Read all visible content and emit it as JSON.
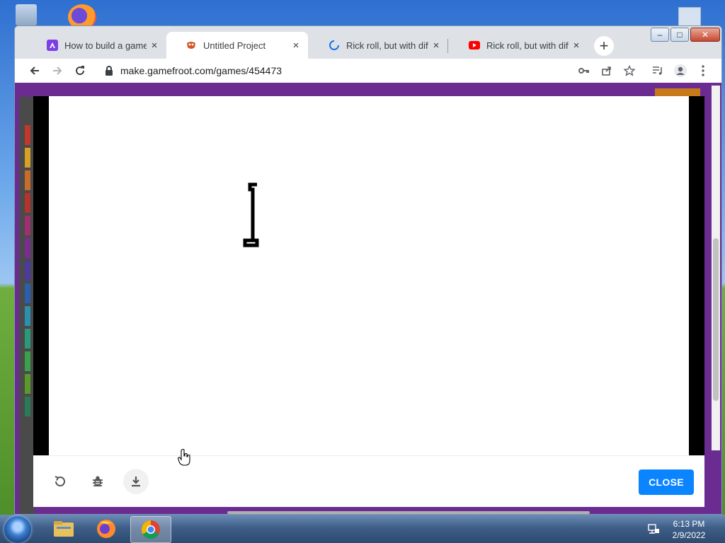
{
  "browser": {
    "tabs": [
      {
        "label": "How to build a game with",
        "favicon": "a-logo-icon",
        "active": false
      },
      {
        "label": "Untitled Project",
        "favicon": "gamefroot-icon",
        "active": true
      },
      {
        "label": "Rick roll, but with differe",
        "favicon": "loading-spinner-icon",
        "active": false
      },
      {
        "label": "Rick roll, but with differe",
        "favicon": "youtube-icon",
        "active": false
      }
    ],
    "tab_close": "×",
    "new_tab": "+",
    "url": "make.gamefroot.com/games/454473",
    "window_controls": {
      "minimize": "–",
      "restore": "□",
      "close": "✕"
    }
  },
  "modal": {
    "close_label": "CLOSE"
  },
  "taskbar": {
    "time": "6:13 PM",
    "date": "2/9/2022"
  },
  "colors": {
    "page_bg": "#6a2c91",
    "close_button": "#0a84ff",
    "tab_strip": "#dee1e6"
  }
}
